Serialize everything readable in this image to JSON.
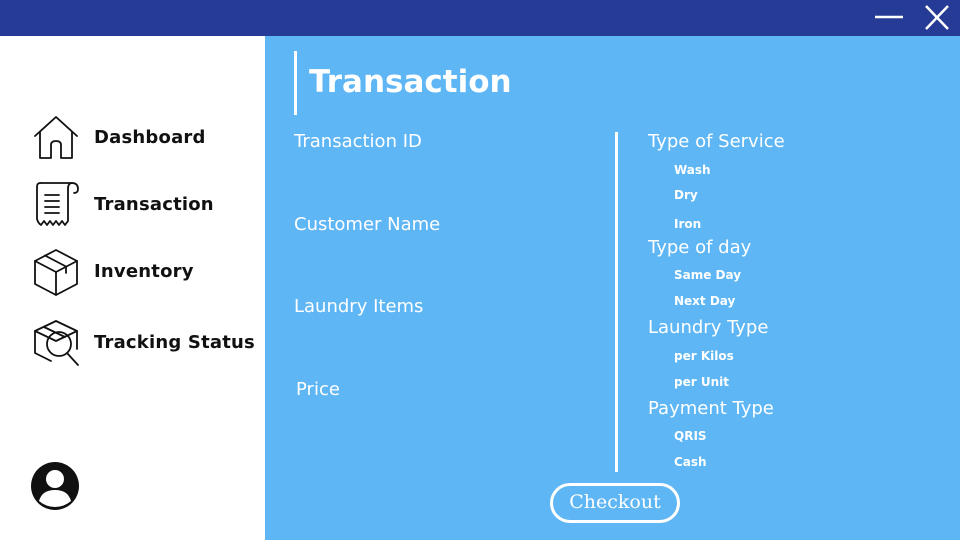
{
  "window": {
    "minimize_icon": "minimize-icon",
    "close_icon": "close-icon"
  },
  "sidebar": {
    "items": [
      {
        "label": "Dashboard",
        "icon": "home-icon"
      },
      {
        "label": "Transaction",
        "icon": "receipt-icon"
      },
      {
        "label": "Inventory",
        "icon": "box-icon"
      },
      {
        "label": "Tracking Status",
        "icon": "box-search-icon"
      }
    ],
    "avatar_icon": "user-avatar-icon"
  },
  "main": {
    "title": "Transaction",
    "fields": [
      {
        "label": "Transaction ID"
      },
      {
        "label": "Customer Name"
      },
      {
        "label": "Laundry Items"
      },
      {
        "label": "Price"
      }
    ],
    "groups": [
      {
        "title": "Type of Service",
        "options": [
          "Wash",
          "Dry",
          "Iron"
        ]
      },
      {
        "title": "Type of day",
        "options": [
          "Same Day",
          "Next Day"
        ]
      },
      {
        "title": "Laundry Type",
        "options": [
          "per Kilos",
          "per Unit"
        ]
      },
      {
        "title": "Payment Type",
        "options": [
          "QRIS",
          "Cash"
        ]
      }
    ],
    "checkout_label": "Checkout"
  },
  "colors": {
    "titlebar": "#263b96",
    "main_bg": "#5fb6f5",
    "sidebar_bg": "#ffffff",
    "text_light": "#ffffff",
    "text_dark": "#111111"
  }
}
